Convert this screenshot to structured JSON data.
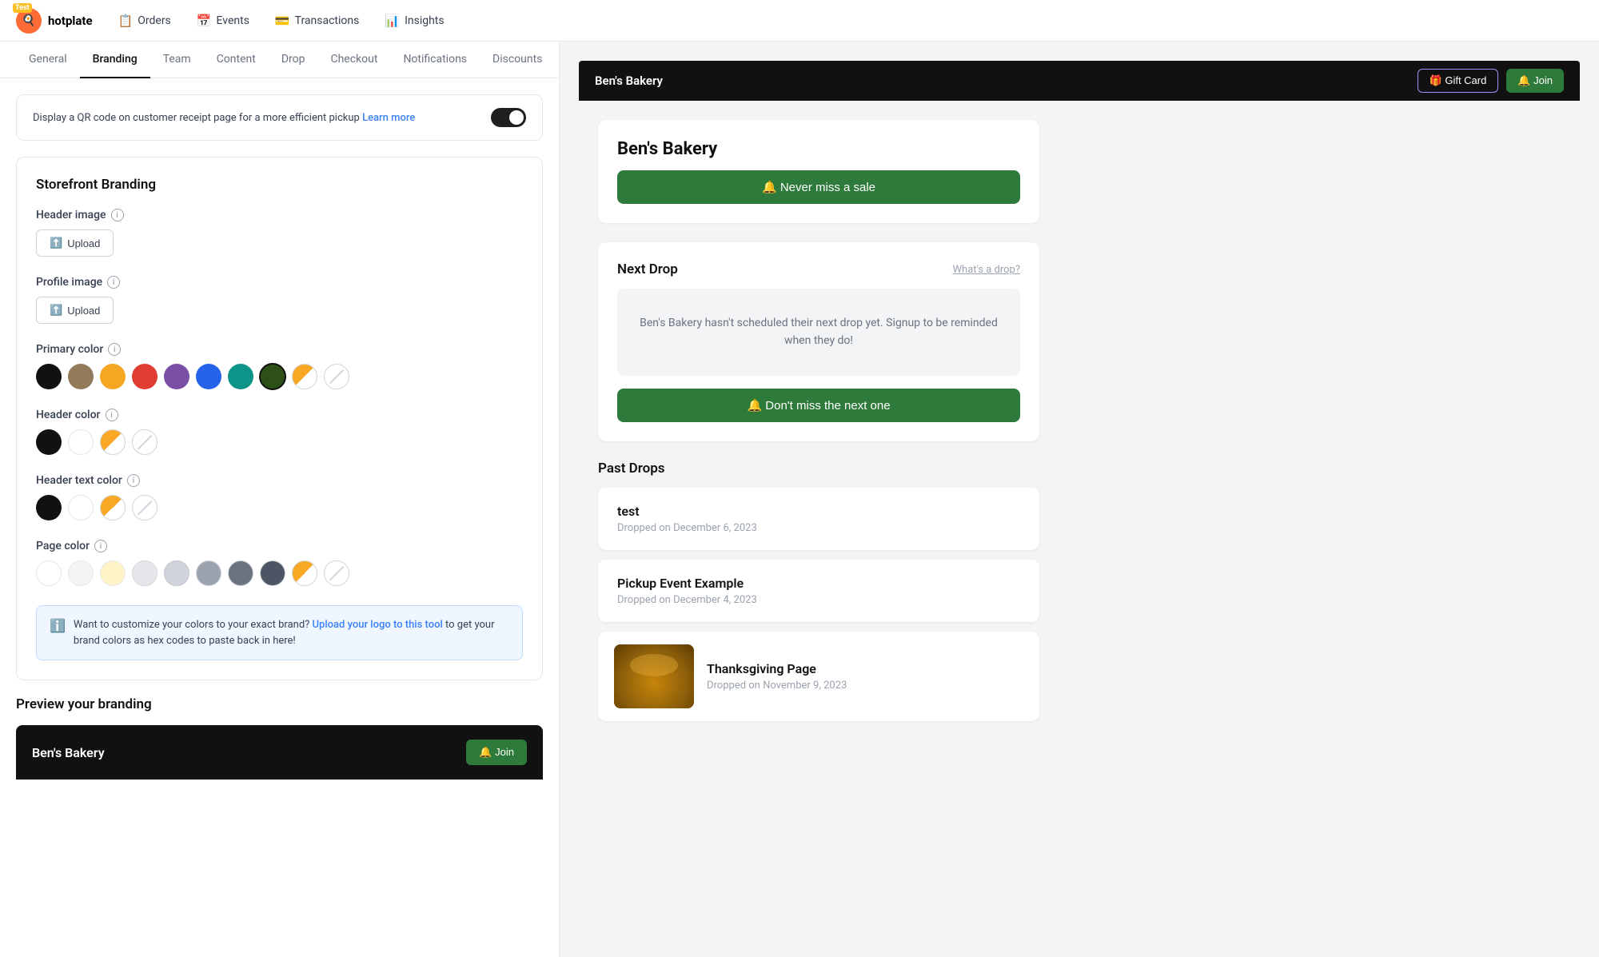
{
  "app": {
    "logo_letter": "🍳",
    "logo_test_badge": "Test",
    "name": "hotplate"
  },
  "top_nav": {
    "items": [
      {
        "id": "orders",
        "label": "Orders",
        "icon": "📋"
      },
      {
        "id": "events",
        "label": "Events",
        "icon": "📅"
      },
      {
        "id": "transactions",
        "label": "Transactions",
        "icon": "💳"
      },
      {
        "id": "insights",
        "label": "Insights",
        "icon": "📊"
      }
    ]
  },
  "sub_nav": {
    "items": [
      {
        "id": "general",
        "label": "General"
      },
      {
        "id": "branding",
        "label": "Branding",
        "active": true
      },
      {
        "id": "team",
        "label": "Team"
      },
      {
        "id": "content",
        "label": "Content"
      },
      {
        "id": "drop",
        "label": "Drop"
      },
      {
        "id": "checkout",
        "label": "Checkout"
      },
      {
        "id": "notifications",
        "label": "Notifications"
      },
      {
        "id": "discounts",
        "label": "Discounts"
      }
    ]
  },
  "qr_banner": {
    "text": "Display a QR code on customer receipt page for a more efficient pickup",
    "link_text": "Learn more",
    "toggle_state": "on"
  },
  "storefront_branding": {
    "title": "Storefront Branding",
    "header_image": {
      "label": "Header image",
      "button_label": "Upload"
    },
    "profile_image": {
      "label": "Profile image",
      "button_label": "Upload"
    },
    "primary_color": {
      "label": "Primary color",
      "swatches": [
        {
          "id": "black",
          "color": "#111111",
          "selected": false
        },
        {
          "id": "brown",
          "color": "#92795a",
          "selected": false
        },
        {
          "id": "yellow",
          "color": "#f5a623",
          "selected": false
        },
        {
          "id": "red",
          "color": "#e03c31",
          "selected": false
        },
        {
          "id": "purple",
          "color": "#7b4fa6",
          "selected": false
        },
        {
          "id": "blue",
          "color": "#2563eb",
          "selected": false
        },
        {
          "id": "teal",
          "color": "#0d9488",
          "selected": false
        },
        {
          "id": "dark-green",
          "color": "#2d5016",
          "selected": true
        },
        {
          "id": "custom",
          "type": "custom"
        },
        {
          "id": "none",
          "type": "none"
        }
      ]
    },
    "header_color": {
      "label": "Header color",
      "swatches": [
        {
          "id": "black",
          "color": "#111111",
          "selected": false
        },
        {
          "id": "white",
          "color": "#ffffff",
          "selected": false
        },
        {
          "id": "custom",
          "type": "custom"
        },
        {
          "id": "none",
          "type": "none"
        }
      ]
    },
    "header_text_color": {
      "label": "Header text color",
      "swatches": [
        {
          "id": "black",
          "color": "#111111",
          "selected": false
        },
        {
          "id": "white",
          "color": "#ffffff",
          "selected": false
        },
        {
          "id": "custom",
          "type": "custom"
        },
        {
          "id": "none",
          "type": "none"
        }
      ]
    },
    "page_color": {
      "label": "Page color",
      "swatches": [
        {
          "id": "white",
          "color": "#ffffff",
          "selected": false
        },
        {
          "id": "lightgray1",
          "color": "#f3f4f6",
          "selected": false
        },
        {
          "id": "cream",
          "color": "#fef3c7",
          "selected": false
        },
        {
          "id": "lightgray2",
          "color": "#e5e7eb",
          "selected": false
        },
        {
          "id": "lightgray3",
          "color": "#d1d5db",
          "selected": false
        },
        {
          "id": "lightgray4",
          "color": "#9ca3af",
          "selected": false
        },
        {
          "id": "lightgray5",
          "color": "#6b7280",
          "selected": false
        },
        {
          "id": "lightgray6",
          "color": "#4b5563",
          "selected": false
        },
        {
          "id": "custom",
          "type": "custom"
        },
        {
          "id": "none",
          "type": "none"
        }
      ]
    },
    "info_banner": {
      "text": "Want to customize your colors to your exact brand?",
      "link_text": "Upload your logo to this tool",
      "text_after": "to get your brand colors as hex codes to paste back in here!"
    },
    "preview_title": "Preview your branding"
  },
  "preview": {
    "bakery_name": "Ben's Bakery",
    "join_label": "🔔 Join"
  },
  "right_panel": {
    "header": {
      "bakery_name": "Ben's Bakery",
      "gift_card_label": "🎁 Gift Card",
      "join_label": "🔔 Join"
    },
    "bakery_card": {
      "name": "Ben's Bakery",
      "never_miss_label": "🔔 Never miss a sale"
    },
    "next_drop": {
      "heading": "Next Drop",
      "whats_drop_link": "What's a drop?",
      "no_drop_text": "Ben's Bakery hasn't scheduled their next drop yet. Signup to be reminded when they do!",
      "dont_miss_label": "🔔 Don't miss the next one"
    },
    "past_drops": {
      "heading": "Past Drops",
      "items": [
        {
          "id": "test-drop",
          "name": "test",
          "date": "Dropped on December 6, 2023",
          "has_image": false
        },
        {
          "id": "pickup-event",
          "name": "Pickup Event Example",
          "date": "Dropped on December 4, 2023",
          "has_image": false
        },
        {
          "id": "thanksgiving",
          "name": "Thanksgiving Page",
          "date": "Dropped on November 9, 2023",
          "has_image": true
        }
      ]
    }
  }
}
